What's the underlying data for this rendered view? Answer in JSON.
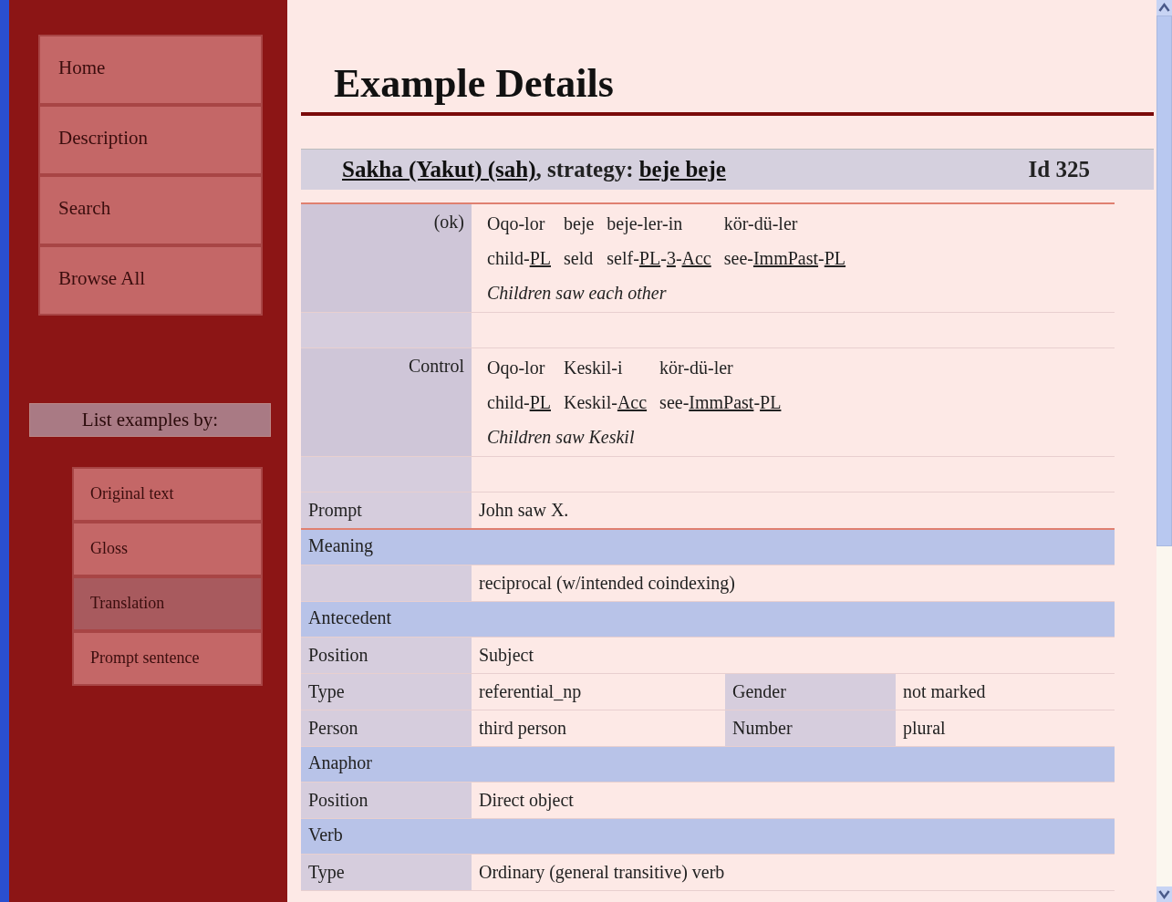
{
  "sidebar": {
    "menu": [
      {
        "label": "Home"
      },
      {
        "label": "Description"
      },
      {
        "label": "Search"
      },
      {
        "label": "Browse All"
      }
    ],
    "list_heading": "List examples by:",
    "list_items": [
      {
        "label": "Original text",
        "selected": false
      },
      {
        "label": "Gloss",
        "selected": false
      },
      {
        "label": "Translation",
        "selected": true
      },
      {
        "label": "Prompt sentence",
        "selected": false
      }
    ]
  },
  "page_title": "Example Details",
  "header": {
    "language": "Sakha (Yakut) (sah)",
    "separator": ", strategy: ",
    "strategy": "beje beje",
    "id": "Id 325"
  },
  "rows": [
    {
      "kind": "example",
      "label": "(ok)",
      "words": [
        {
          "word": "Oqo-lor",
          "gloss": [
            {
              "text": "child-"
            },
            {
              "text": "PL",
              "abbr": true
            }
          ]
        },
        {
          "word": "beje",
          "gloss": [
            {
              "text": "seld"
            }
          ]
        },
        {
          "word": "beje-ler-in",
          "gloss": [
            {
              "text": "self-"
            },
            {
              "text": "PL",
              "abbr": true
            },
            {
              "text": "-"
            },
            {
              "text": "3",
              "abbr": true
            },
            {
              "text": "-"
            },
            {
              "text": "Acc",
              "abbr": true
            }
          ]
        },
        {
          "word": "kör-dü-ler",
          "gloss": [
            {
              "text": "see-"
            },
            {
              "text": "ImmPast",
              "abbr": true
            },
            {
              "text": "-"
            },
            {
              "text": "PL",
              "abbr": true
            }
          ]
        }
      ],
      "translation": "Children saw each other"
    },
    {
      "kind": "spacer"
    },
    {
      "kind": "example",
      "label": "Control",
      "words": [
        {
          "word": "Oqo-lor",
          "gloss": [
            {
              "text": "child-"
            },
            {
              "text": "PL",
              "abbr": true
            }
          ]
        },
        {
          "word": "Keskil-i",
          "gloss": [
            {
              "text": "Keskil-"
            },
            {
              "text": "Acc",
              "abbr": true
            }
          ]
        },
        {
          "word": "kör-dü-ler",
          "gloss": [
            {
              "text": "see-"
            },
            {
              "text": "ImmPast",
              "abbr": true
            },
            {
              "text": "-"
            },
            {
              "text": "PL",
              "abbr": true
            }
          ]
        }
      ],
      "translation": "Children saw Keskil"
    },
    {
      "kind": "spacer"
    },
    {
      "kind": "field",
      "label": "Prompt",
      "value": "John saw X."
    },
    {
      "kind": "section",
      "label": "Meaning"
    },
    {
      "kind": "field",
      "label": "",
      "value": "reciprocal (w/intended coindexing)"
    },
    {
      "kind": "section",
      "label": "Antecedent"
    },
    {
      "kind": "field",
      "label": "Position",
      "value": "Subject"
    },
    {
      "kind": "pair",
      "label": "Type",
      "value": "referential_np",
      "label2": "Gender",
      "value2": "not marked"
    },
    {
      "kind": "pair",
      "label": "Person",
      "value": "third person",
      "label2": "Number",
      "value2": "plural"
    },
    {
      "kind": "section",
      "label": "Anaphor"
    },
    {
      "kind": "field",
      "label": "Position",
      "value": "Direct object"
    },
    {
      "kind": "section",
      "label": "Verb"
    },
    {
      "kind": "field",
      "label": "Type",
      "value": "Ordinary (general transitive) verb"
    }
  ]
}
